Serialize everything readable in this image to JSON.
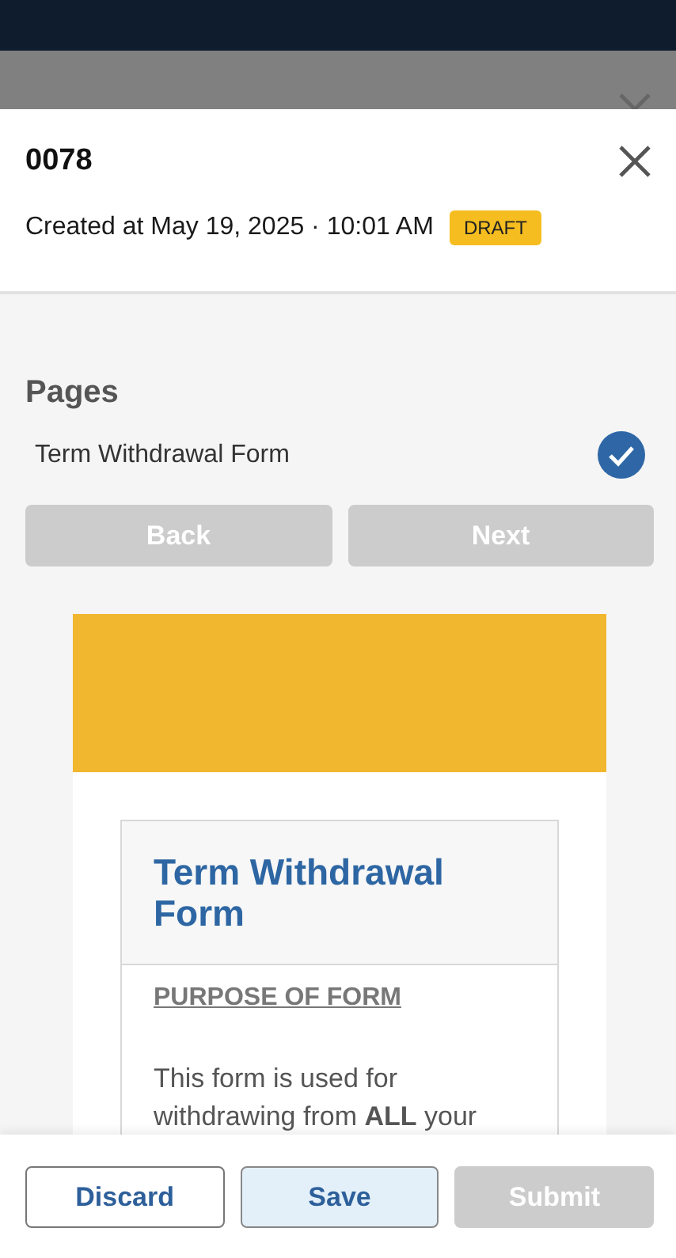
{
  "sheet": {
    "title": "0078",
    "created": "Created at May 19, 2025 · 10:01 AM",
    "status": "DRAFT"
  },
  "pages": {
    "heading": "Pages",
    "items": [
      {
        "label": "Term Withdrawal Form",
        "checked": true
      }
    ]
  },
  "nav_buttons": [
    {
      "label": "Back",
      "disabled": true
    },
    {
      "label": "Next",
      "disabled": true
    }
  ],
  "preview": {
    "title": "Term Withdrawal Form",
    "section": "PURPOSE OF FORM",
    "text": "This form is used for withdrawing from **ALL** your"
  },
  "actions": [
    {
      "label": "Discard",
      "kind": "outline",
      "disabled": false
    },
    {
      "label": "Save",
      "kind": "tinted",
      "disabled": false
    },
    {
      "label": "Submit",
      "disabled": true
    }
  ]
}
